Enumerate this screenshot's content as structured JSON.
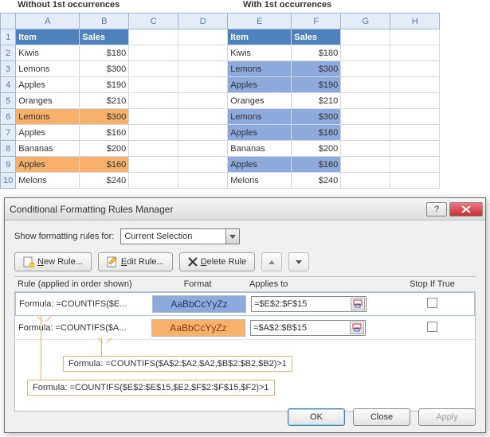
{
  "labels": {
    "left": "Without 1st occurrences",
    "right": "With 1st occurrences"
  },
  "cols": [
    "A",
    "B",
    "C",
    "D",
    "E",
    "F",
    "G",
    "H"
  ],
  "hdr": {
    "item": "Item",
    "sales": "Sales"
  },
  "rows": [
    {
      "n": "2",
      "a": "Kiwis",
      "b": "$180",
      "e": "Kiwis",
      "f": "$180"
    },
    {
      "n": "3",
      "a": "Lemons",
      "b": "$300",
      "e": "Lemons",
      "f": "$300",
      "efHL": "blue"
    },
    {
      "n": "4",
      "a": "Apples",
      "b": "$190",
      "e": "Apples",
      "f": "$190",
      "efHL": "blue"
    },
    {
      "n": "5",
      "a": "Oranges",
      "b": "$210",
      "e": "Oranges",
      "f": "$210"
    },
    {
      "n": "6",
      "a": "Lemons",
      "b": "$300",
      "abHL": "orange",
      "e": "Lemons",
      "f": "$300",
      "efHL": "blue"
    },
    {
      "n": "7",
      "a": "Apples",
      "b": "$160",
      "e": "Apples",
      "f": "$160",
      "efHL": "blue"
    },
    {
      "n": "8",
      "a": "Bananas",
      "b": "$200",
      "e": "Bananas",
      "f": "$200"
    },
    {
      "n": "9",
      "a": "Apples",
      "b": "$160",
      "abHL": "orange",
      "e": "Apples",
      "f": "$160",
      "efHL": "blue"
    },
    {
      "n": "10",
      "a": "Melons",
      "b": "$240",
      "e": "Melons",
      "f": "$240"
    }
  ],
  "dialog": {
    "title": "Conditional Formatting Rules Manager",
    "showLabel": "Show formatting rules for:",
    "showValue": "Current Selection",
    "newRule": "New Rule...",
    "editRule": "Edit Rule...",
    "deleteRule": "Delete Rule",
    "cols": {
      "rule": "Rule (applied in order shown)",
      "format": "Format",
      "applies": "Applies to",
      "stop": "Stop If True"
    },
    "preview": "AaBbCcYyZz",
    "rules": [
      {
        "text": "Formula: =COUNTIFS($E...",
        "range": "=$E$2:$F$15",
        "color": "blue"
      },
      {
        "text": "Formula: =COUNTIFS($A...",
        "range": "=$A$2:$B$15",
        "color": "orange"
      }
    ],
    "callouts": [
      "Formula: =COUNTIFS($A$2:$A2,$A2,$B$2:$B2,$B2)>1",
      "Formula: =COUNTIFS($E$2:$E$15,$E2,$F$2:$F$15,$F2)>1"
    ],
    "ok": "OK",
    "close": "Close",
    "apply": "Apply"
  }
}
